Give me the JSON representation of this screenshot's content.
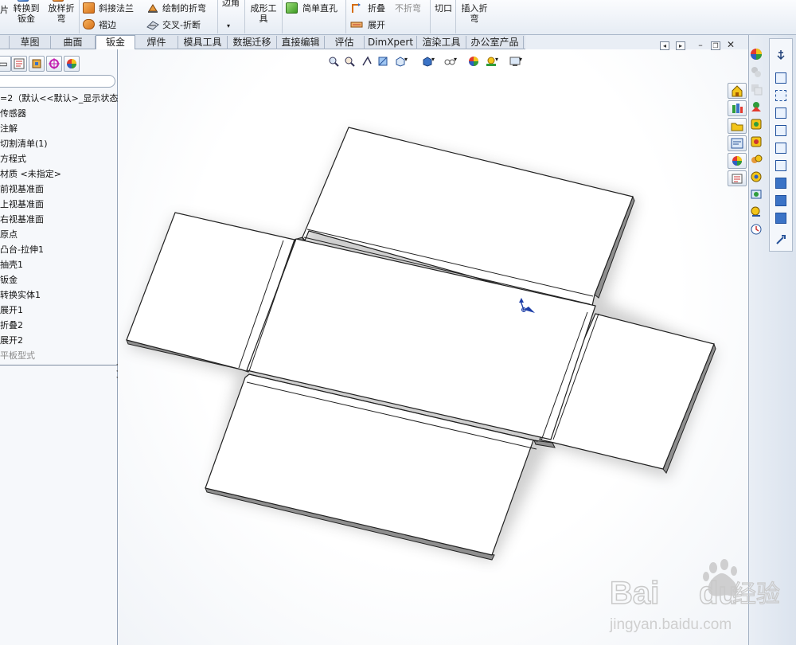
{
  "ribbon": {
    "items": [
      {
        "key": "pian",
        "label": "片"
      },
      {
        "key": "convert",
        "label": "转换到\n钣金"
      },
      {
        "key": "loft",
        "label": "放样折\n弯"
      },
      {
        "key": "miter",
        "label": "斜接法兰"
      },
      {
        "key": "hem",
        "label": "褶边"
      },
      {
        "key": "sketched",
        "label": "绘制的折弯"
      },
      {
        "key": "crossbreak",
        "label": "交叉-折断"
      },
      {
        "key": "corner",
        "label": "边角"
      },
      {
        "key": "forming",
        "label": "成形工\n具"
      },
      {
        "key": "hole",
        "label": "简单直孔"
      },
      {
        "key": "fold",
        "label": "折叠"
      },
      {
        "key": "unfold",
        "label": "展开"
      },
      {
        "key": "nobend",
        "label": "不折弯"
      },
      {
        "key": "rip",
        "label": "切口"
      },
      {
        "key": "insertbend",
        "label": "插入折\n弯"
      }
    ]
  },
  "tabs": [
    {
      "label": "草图",
      "active": false
    },
    {
      "label": "曲面",
      "active": false
    },
    {
      "label": "钣金",
      "active": true
    },
    {
      "label": "焊件",
      "active": false
    },
    {
      "label": "模具工具",
      "active": false
    },
    {
      "label": "数据迁移",
      "active": false
    },
    {
      "label": "直接编辑",
      "active": false
    },
    {
      "label": "评估",
      "active": false
    },
    {
      "label": "DimXpert",
      "active": false
    },
    {
      "label": "渲染工具",
      "active": false
    },
    {
      "label": "办公室产品",
      "active": false
    }
  ],
  "tree": {
    "items": [
      {
        "label": "=2（默认<<默认>_显示状态",
        "suppressed": false
      },
      {
        "label": "传感器",
        "suppressed": false
      },
      {
        "label": "注解",
        "suppressed": false
      },
      {
        "label": "切割清单(1)",
        "suppressed": false
      },
      {
        "label": "方程式",
        "suppressed": false
      },
      {
        "label": "材质 <未指定>",
        "suppressed": false
      },
      {
        "label": "前视基准面",
        "suppressed": false
      },
      {
        "label": "上视基准面",
        "suppressed": false
      },
      {
        "label": "右视基准面",
        "suppressed": false
      },
      {
        "label": "原点",
        "suppressed": false
      },
      {
        "label": "凸台-拉伸1",
        "suppressed": false
      },
      {
        "label": "抽壳1",
        "suppressed": false
      },
      {
        "label": "钣金",
        "suppressed": false
      },
      {
        "label": "转换实体1",
        "suppressed": false
      },
      {
        "label": "展开1",
        "suppressed": false
      },
      {
        "label": "折叠2",
        "suppressed": false
      },
      {
        "label": "展开2",
        "suppressed": false
      },
      {
        "label": "平板型式",
        "suppressed": true
      }
    ]
  },
  "colors": {
    "accent": "#3b73c6",
    "part_face": "#ffffff",
    "part_edge": "#222222",
    "part_side": "#8f8f8f"
  },
  "watermark": {
    "brand": "Bai",
    "brand_suffix": "du",
    "product": "经验",
    "url": "jingyan.baidu.com"
  }
}
